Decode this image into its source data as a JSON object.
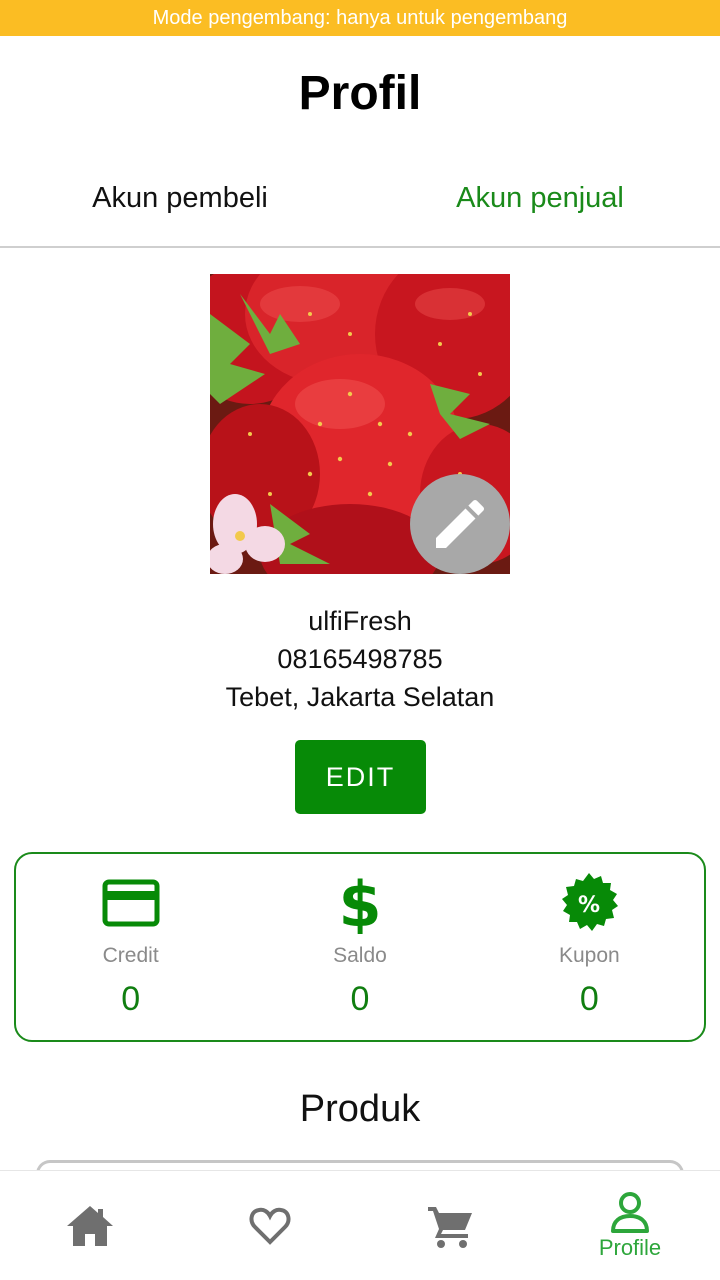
{
  "banner": {
    "text": "Mode pengembang: hanya untuk pengembang"
  },
  "header": {
    "title": "Profil"
  },
  "tabs": [
    {
      "label": "Akun pembeli",
      "active": false
    },
    {
      "label": "Akun penjual",
      "active": true
    }
  ],
  "profile": {
    "name": "ulfiFresh",
    "phone": "08165498785",
    "location": "Tebet, Jakarta Selatan",
    "photo_icon": "pencil-icon",
    "edit_label": "EDIT"
  },
  "wallet": [
    {
      "label": "Credit",
      "value": "0",
      "icon": "credit-card-icon"
    },
    {
      "label": "Saldo",
      "value": "0",
      "icon": "dollar-icon"
    },
    {
      "label": "Kupon",
      "value": "0",
      "icon": "coupon-percent-icon"
    }
  ],
  "products": {
    "title": "Produk"
  },
  "nav": [
    {
      "icon": "home-icon",
      "label": ""
    },
    {
      "icon": "heart-icon",
      "label": ""
    },
    {
      "icon": "cart-icon",
      "label": ""
    },
    {
      "icon": "profile-icon",
      "label": "Profile",
      "active": true
    }
  ],
  "colors": {
    "accent": "#078a07",
    "banner": "#fbbd23",
    "nav_active": "#2da63b",
    "nav_inactive": "#6f6f6f"
  }
}
